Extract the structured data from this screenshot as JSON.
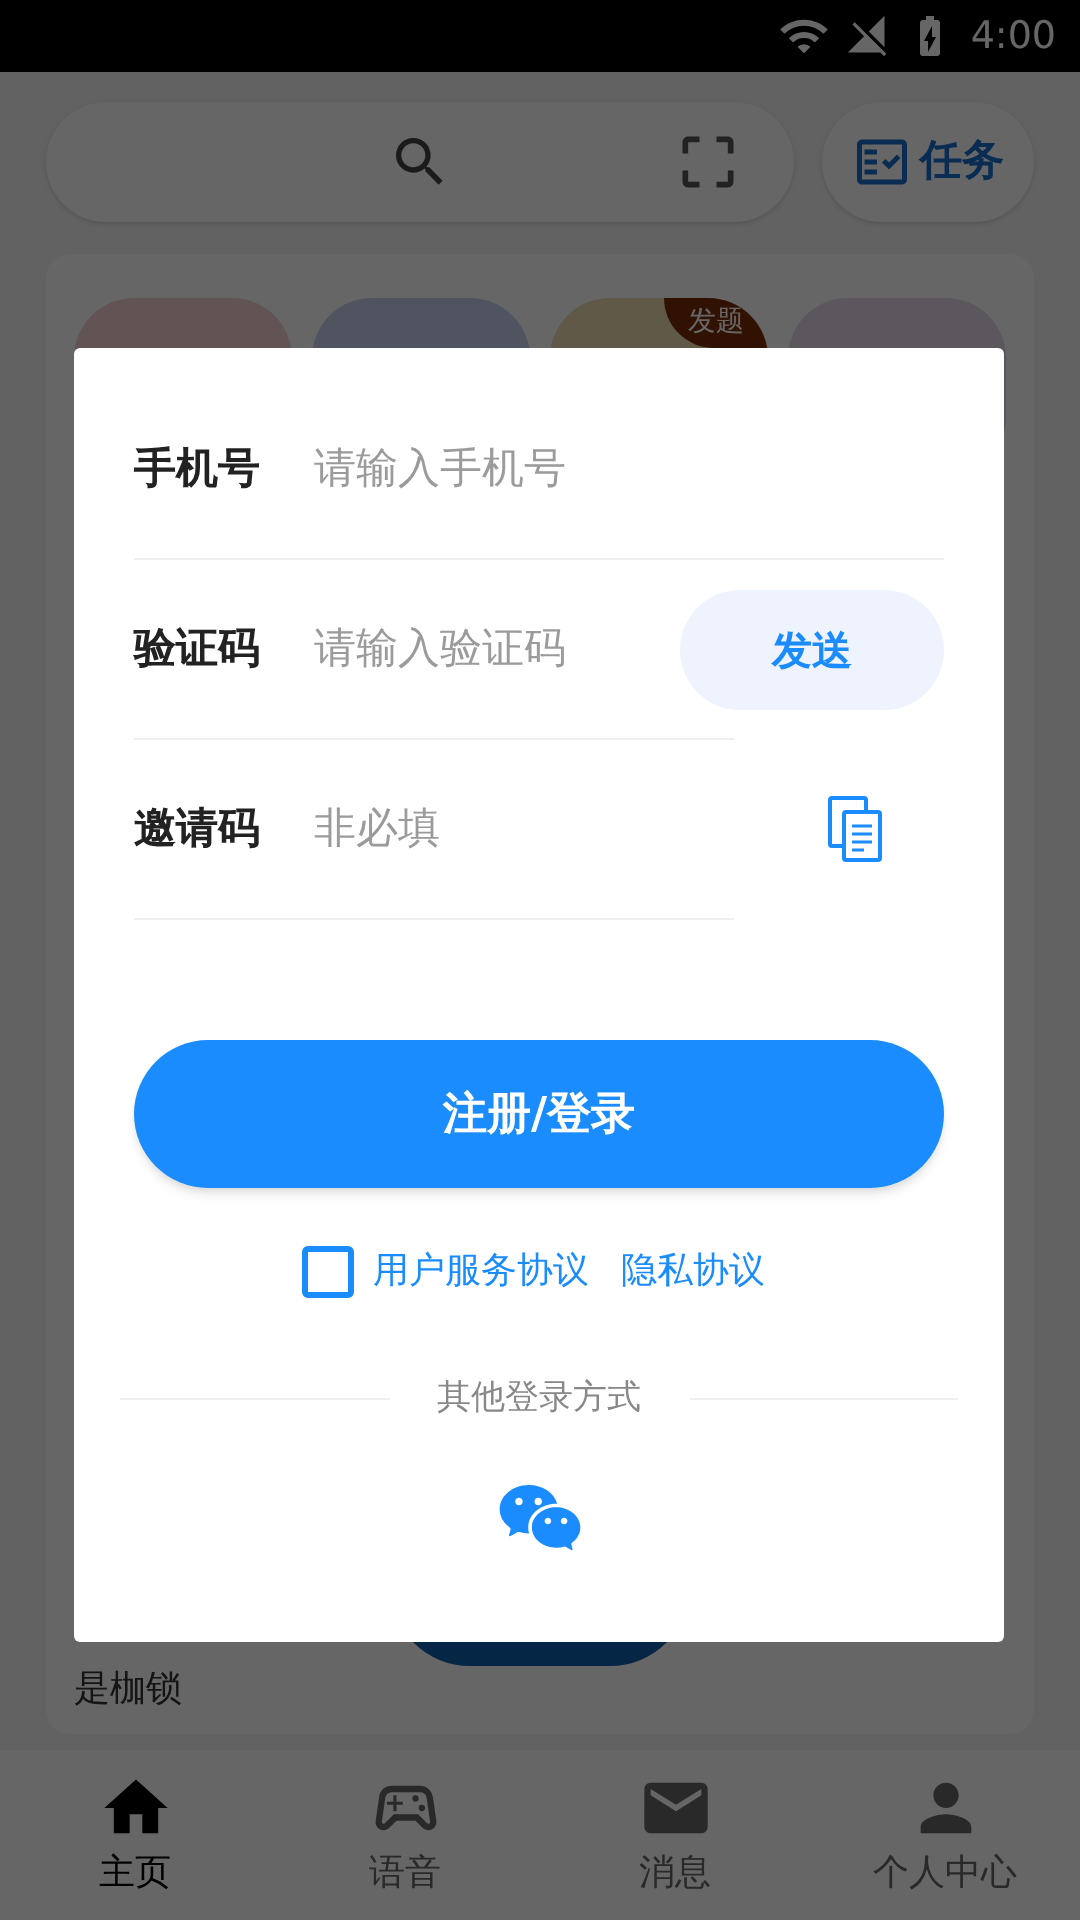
{
  "status_bar": {
    "time": "4:00"
  },
  "task_button": {
    "label": "任务"
  },
  "app_badge": "发题",
  "card_text": "是枷锁",
  "dialog": {
    "fields": [
      {
        "kind": "phone",
        "label": "手机号",
        "placeholder": "请输入手机号"
      },
      {
        "kind": "code",
        "label": "验证码",
        "placeholder": "请输入验证码",
        "button": "发送"
      },
      {
        "kind": "invite",
        "label": "邀请码",
        "placeholder": "非必填"
      }
    ],
    "submit": "注册/登录",
    "agreement": {
      "checked": false,
      "links": [
        "用户服务协议",
        "隐私协议"
      ]
    },
    "other_login": "其他登录方式"
  },
  "nav": [
    {
      "kind": "home",
      "label": "主页",
      "selected": true
    },
    {
      "kind": "voice",
      "label": "语音",
      "selected": false
    },
    {
      "kind": "message",
      "label": "消息",
      "selected": false
    },
    {
      "kind": "profile",
      "label": "个人中心",
      "selected": false
    }
  ]
}
